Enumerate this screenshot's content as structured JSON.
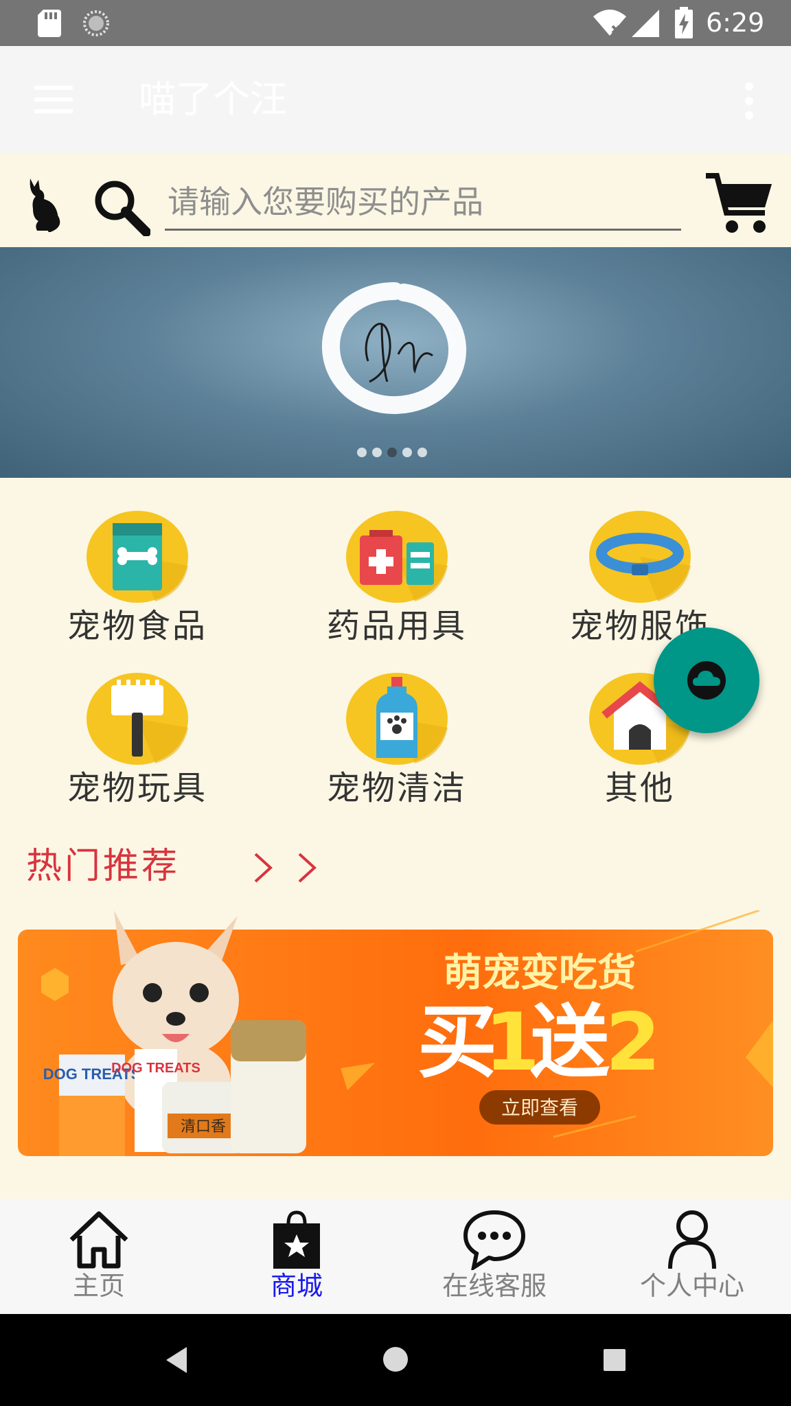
{
  "status_bar": {
    "time": "6:29",
    "icons": [
      "sd-card-icon",
      "loading-spinner-icon",
      "wifi-off-icon",
      "signal-icon",
      "battery-charging-icon"
    ]
  },
  "app_bar": {
    "title": "喵了个汪",
    "icons": [
      "menu-icon",
      "more-vert-icon"
    ]
  },
  "search": {
    "placeholder": "请输入您要购买的产品",
    "icons": [
      "cat-icon",
      "search-icon",
      "cart-icon"
    ]
  },
  "banner": {
    "slide_count": 5,
    "active_slide": 3
  },
  "categories": [
    {
      "label": "宠物食品",
      "icon": "pet-food-icon"
    },
    {
      "label": "药品用具",
      "icon": "medicine-kit-icon"
    },
    {
      "label": "宠物服饰",
      "icon": "pet-collar-icon"
    },
    {
      "label": "宠物玩具",
      "icon": "pet-comb-icon"
    },
    {
      "label": "宠物清洁",
      "icon": "shampoo-bottle-icon"
    },
    {
      "label": "其他",
      "icon": "dog-house-icon"
    }
  ],
  "hot": {
    "title": "热门推荐",
    "arrows": "> >"
  },
  "promo": {
    "headline": "萌宠变吃货",
    "offer_buy": "买",
    "offer_one": "1",
    "offer_give": "送",
    "offer_two": "2",
    "cta": "立即查看",
    "pack_1": "DOG TREATS",
    "pack_2": "DOG TREATS",
    "jar_label": "清口香"
  },
  "fab": {
    "icon": "cloud-icon",
    "color": "#009688"
  },
  "bottom_nav": [
    {
      "label": "主页",
      "icon": "home-icon",
      "active": false
    },
    {
      "label": "商城",
      "icon": "shop-bag-icon",
      "active": true
    },
    {
      "label": "在线客服",
      "icon": "chat-icon",
      "active": false
    },
    {
      "label": "个人中心",
      "icon": "person-icon",
      "active": false
    }
  ],
  "system_nav": [
    "back-icon",
    "home-circle-icon",
    "recents-icon"
  ],
  "colors": {
    "accent": "#1a1aee",
    "hot_red": "#d8343f",
    "category_yellow": "#f6c521",
    "background": "#fbf7e4",
    "promo_orange": "#ff7a12"
  }
}
